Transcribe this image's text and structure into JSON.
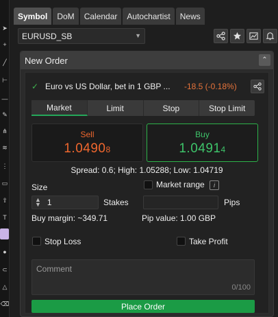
{
  "tabs": [
    "Symbol",
    "DoM",
    "Calendar",
    "Autochartist",
    "News"
  ],
  "symbol": {
    "value": "EURUSD_SB"
  },
  "toolbar_icons": [
    "share-icon",
    "star-icon",
    "chart-icon",
    "bell-icon"
  ],
  "panel": {
    "title": "New Order",
    "collapse_glyph": "⌃"
  },
  "instrument": {
    "name": "Euro vs US Dollar, bet in 1 GBP ...",
    "change": "-18.5 (-0.18%)",
    "change_color": "#e8743b"
  },
  "order_tabs": [
    "Market",
    "Limit",
    "Stop",
    "Stop Limit"
  ],
  "sell": {
    "label": "Sell",
    "price_main": "1.0490",
    "price_last": "8",
    "color": "#f0672e"
  },
  "buy": {
    "label": "Buy",
    "price_main": "1.0491",
    "price_last": "4",
    "color": "#3ec46a"
  },
  "stats": "Spread: 0.6; High: 1.05288; Low: 1.04719",
  "size": {
    "label": "Size",
    "value": "1",
    "unit": "Stakes"
  },
  "market_range": {
    "label": "Market range",
    "unit": "Pips",
    "value": ""
  },
  "buy_margin": "Buy margin: ~349.71",
  "pip_value": "Pip value: 1.00 GBP",
  "stop_loss": "Stop Loss",
  "take_profit": "Take Profit",
  "comment": {
    "placeholder": "Comment",
    "counter": "0/100"
  },
  "place_order": "Place Order",
  "colors": {
    "accent_green": "#1b9b45",
    "sell_orange": "#f0672e",
    "buy_green": "#3ec46a"
  }
}
